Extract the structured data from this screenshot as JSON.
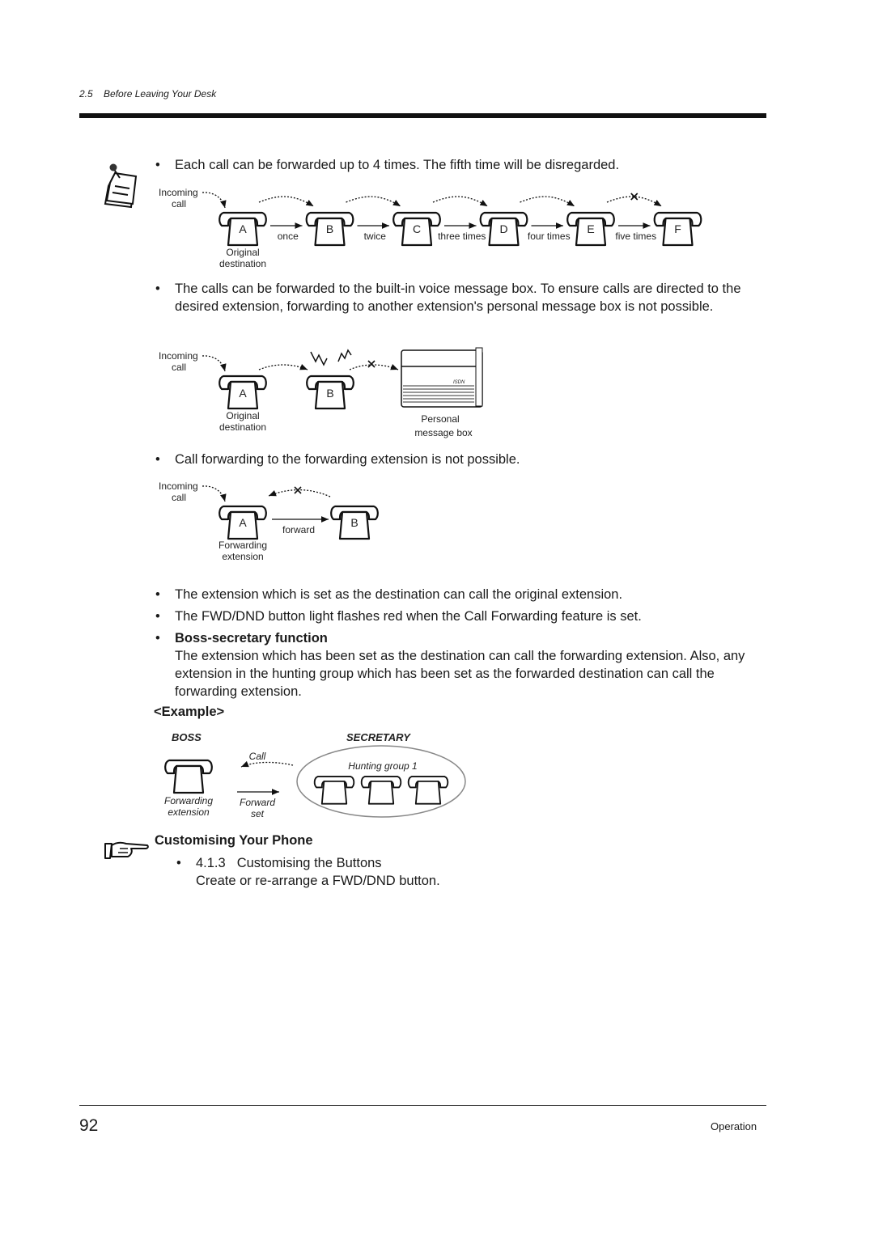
{
  "header": {
    "section_number": "2.5",
    "section_title": "Before Leaving Your Desk"
  },
  "notes": [
    "Each call can be forwarded up to 4 times. The fifth time will be disregarded.",
    "The calls can be forwarded to the built-in voice message box. To ensure calls are directed to the desired extension, forwarding to another extension's personal message box is not possible.",
    "Call forwarding to the forwarding extension is not possible.",
    "The extension which is set as the destination can call the original extension.",
    "The FWD/DND button light flashes red when the Call Forwarding feature is set."
  ],
  "diagram1": {
    "incoming_line1": "Incoming",
    "incoming_line2": "call",
    "phones": [
      "A",
      "B",
      "C",
      "D",
      "E",
      "F"
    ],
    "arrow_labels": [
      "once",
      "twice",
      "three times",
      "four times",
      "five times"
    ],
    "origin_line1": "Original",
    "origin_line2": "destination"
  },
  "diagram2": {
    "incoming_line1": "Incoming",
    "incoming_line2": "call",
    "phones": [
      "A",
      "B"
    ],
    "origin_line1": "Original",
    "origin_line2": "destination",
    "box_line1": "Personal",
    "box_line2": "message box",
    "device_brand": "ISDN"
  },
  "diagram3": {
    "incoming_line1": "Incoming",
    "incoming_line2": "call",
    "phones": [
      "A",
      "B"
    ],
    "arrow_label": "forward",
    "origin_line1": "Forwarding",
    "origin_line2": "extension"
  },
  "boss_secretary": {
    "title": "Boss-secretary function",
    "text": "The extension which has been set as the destination can call the forwarding extension. Also, any extension in the hunting group which has been set as the forwarded destination can call the forwarding extension."
  },
  "example": {
    "heading": "<Example>",
    "boss_label": "BOSS",
    "secretary_label": "SECRETARY",
    "call_label": "Call",
    "hunting_group": "Hunting group 1",
    "forward_line1": "Forward",
    "forward_line2": "set",
    "boss_ext_line1": "Forwarding",
    "boss_ext_line2": "extension"
  },
  "reference": {
    "title": "Customising Your Phone",
    "item_number": "4.1.3",
    "item_title": "Customising the Buttons",
    "item_desc": "Create or re-arrange a FWD/DND button."
  },
  "footer": {
    "page_number": "92",
    "section": "Operation"
  }
}
